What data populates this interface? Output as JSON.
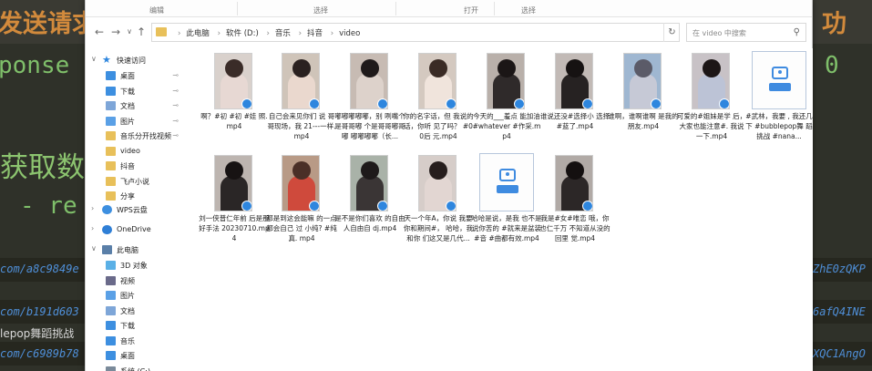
{
  "console": {
    "head_left": "发送请求",
    "head_right": "功",
    "mono_left": "ponse",
    "mono_right": "0",
    "big_left": "获取数",
    "dash_text": "- re",
    "urls_left": [
      "com/a8c9849e",
      "com/b191d603",
      "com/c6989b78"
    ],
    "urls_right": [
      "ZhE0zQKP",
      "6afQ4INE",
      "XQC1AngO"
    ],
    "text_line": "lepop舞蹈挑战"
  },
  "explorer": {
    "ribbon_labels": [
      "编辑",
      "选择",
      "打开",
      "选择"
    ],
    "breadcrumb": [
      "此电脑",
      "软件 (D:)",
      "音乐",
      "抖音",
      "video"
    ],
    "search_placeholder": "在 video 中搜索",
    "nav": {
      "quick_access": "快速访问",
      "items": [
        {
          "label": "桌面",
          "icon": "desktop-icon",
          "color": "#3d8fe0",
          "pinned": true
        },
        {
          "label": "下载",
          "icon": "download-icon",
          "color": "#3d8fe0",
          "pinned": true
        },
        {
          "label": "文档",
          "icon": "document-icon",
          "color": "#7ea6d8",
          "pinned": true
        },
        {
          "label": "图片",
          "icon": "picture-icon",
          "color": "#5aa0e6",
          "pinned": true
        },
        {
          "label": "音乐分开找视频",
          "icon": "folder-icon",
          "color": "#e8c05a",
          "pinned": true
        },
        {
          "label": "video",
          "icon": "folder-icon",
          "color": "#e8c05a",
          "pinned": false
        },
        {
          "label": "抖音",
          "icon": "folder-icon",
          "color": "#e8c05a",
          "pinned": false
        },
        {
          "label": "飞卢小说",
          "icon": "folder-icon",
          "color": "#e8c05a",
          "pinned": false
        },
        {
          "label": "分享",
          "icon": "folder-icon",
          "color": "#e8c05a",
          "pinned": false
        }
      ],
      "wps": "WPS云盘",
      "onedrive": "OneDrive",
      "thispc": "此电脑",
      "pc_items": [
        {
          "label": "3D 对象",
          "icon": "3d-objects-icon",
          "color": "#5ab0e6"
        },
        {
          "label": "视频",
          "icon": "video-icon",
          "color": "#6a6a8a"
        },
        {
          "label": "图片",
          "icon": "picture-icon",
          "color": "#5aa0e6"
        },
        {
          "label": "文档",
          "icon": "document-icon",
          "color": "#7ea6d8"
        },
        {
          "label": "下载",
          "icon": "download-icon",
          "color": "#3d8fe0"
        },
        {
          "label": "音乐",
          "icon": "music-icon",
          "color": "#3d8fe0"
        },
        {
          "label": "桌面",
          "icon": "desktop-icon",
          "color": "#3d8fe0"
        },
        {
          "label": "系统 (C:)",
          "icon": "drive-icon",
          "color": "#7a8a9a"
        }
      ]
    },
    "files": [
      {
        "name": "啊？#初 #初 #娃 照.mp4",
        "kind": "video",
        "bg": "#d9d1cc",
        "hair": "#3a2c28",
        "top": "#e7d8d3"
      },
      {
        "name": "自己会来见你们 说 哥哥现场，我 21---一样.mp4",
        "kind": "video",
        "bg": "#cfc4b9",
        "hair": "#2a2120",
        "top": "#ead8ce"
      },
      {
        "name": "嘟嘟嘟嘟嘟，别 咧嘴个是哥哥嘟 个是哥哥嘟哥嘟 嘟嘟嘟嘟（长...",
        "kind": "video",
        "bg": "#c7bbb3",
        "hair": "#1f1a1a",
        "top": "#ddd2cb"
      },
      {
        "name": "你的名字话，但 我说的话，你听 见了吗？ #00后 元.mp4",
        "kind": "video",
        "bg": "#d4c9c0",
        "hair": "#3a2b25",
        "top": "#f0e4dc"
      },
      {
        "name": "今天的___羞点 能加油#whatever #作采.mp4",
        "kind": "video",
        "bg": "#b9b0aa",
        "hair": "#1b1616",
        "top": "#2f2a2a"
      },
      {
        "name": "谁说还没#选择小 选择 #蓝了.mp4",
        "kind": "video",
        "bg": "#c2bab6",
        "hair": "#161212",
        "top": "#262222"
      },
      {
        "name": "谁啊，谁啊谁啊 是我的朋友.mp4",
        "kind": "video",
        "bg": "#9fb7d1",
        "hair": "#5b5b68",
        "top": "#c6c9d6"
      },
      {
        "name": "可爱的#姐妹是学 后，大家也能注意#. 我说一下.mp4",
        "kind": "video",
        "bg": "#c8c2c6",
        "hair": "#1c1616",
        "top": "#bcc3d6"
      },
      {
        "name": "#武林，我要 , 我还几下 #bubblepop舞 蹈挑战 #nana...",
        "kind": "file"
      },
      {
        "name": "刘一侠普仁年前 后是那好手法 20230710.mp4",
        "kind": "video",
        "bg": "#bdb5b0",
        "hair": "#171313",
        "top": "#2a2626"
      },
      {
        "name": "都是到这会能嘛 的一点都会自己 过 小纯? #纯真. mp4",
        "kind": "video",
        "bg": "#b89a86",
        "hair": "#4a2f27",
        "top": "#cf4a3c"
      },
      {
        "name": "是不是你们喜欢 的自由人自由自 dj.mp4",
        "kind": "video",
        "bg": "#a9b2a8",
        "hair": "#1e1a1a",
        "top": "#3a3535"
      },
      {
        "name": "天一个年A，你说 我要你和期间#， 哈哈，我和你 们这又是几代...",
        "kind": "video",
        "bg": "#d6cdc9",
        "hair": "#261e1d",
        "top": "#e2d6d2"
      },
      {
        "name": "哈哈是说，是我 也不是说你苦的 #就来是盆装#音 #曲都有效.mp4",
        "kind": "file"
      },
      {
        "name": "我是#女#唯恋 哦，你也仁千万 不知道从没的回里 觉.mp4",
        "kind": "video",
        "bg": "#b1aaa6",
        "hair": "#141010",
        "top": "#2c2727"
      }
    ]
  }
}
